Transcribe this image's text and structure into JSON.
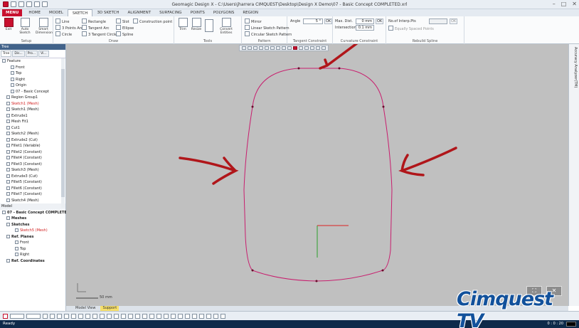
{
  "window": {
    "title": "Geomagic Design X - C:\\Users\\jharrera CIMQUEST\\Desktop\\Design X Demo\\07 - Basic Concept COMPLETED.xrl"
  },
  "menu_tabs": [
    "MENU",
    "HOME",
    "MODEL",
    "SKETCH",
    "3D SKETCH",
    "ALIGNMENT",
    "SURFACING",
    "POINTS",
    "POLYGONS",
    "REGION"
  ],
  "ribbon": {
    "setup": {
      "label": "Setup",
      "exit": "Exit",
      "auto_sketch": "Auto Sketch",
      "smart_dimension": "Smart Dimension"
    },
    "draw": {
      "label": "Draw",
      "items": [
        "Line",
        "Rectangle",
        "Slot",
        "Construction point",
        "3 Points Arc",
        "Tangent Arc",
        "Ellipse",
        "Circle",
        "3 Tangent Circle",
        "Spline"
      ]
    },
    "tools": {
      "label": "Tools",
      "items": [
        "Trim",
        "Resize",
        "Convert Entities"
      ]
    },
    "pattern": {
      "label": "Pattern",
      "items": [
        "Mirror",
        "Linear Sketch Pattern",
        "Circular Sketch Pattern"
      ]
    },
    "tangent_constraint": {
      "label": "Tangent Constraint",
      "angle_label": "Angle",
      "angle_value": "5 °",
      "ok": "OK"
    },
    "curvature_constraint": {
      "label": "Curvature Constraint",
      "max_dist_label": "Max. Dist.",
      "max_dist_value": "0 mm",
      "intersection_label": "Intersection",
      "intersection_value": "0.1 mm",
      "ok": "OK"
    },
    "rebuild_spline": {
      "label": "Rebuild Spline",
      "num_pts_label": "No.of Interp.Pts",
      "equal_spaced": "Equally Spaced Points",
      "ok": "OK"
    }
  },
  "tree_panel": {
    "title": "Tree",
    "tabs": [
      "Tree",
      "Dis...",
      "Pro...",
      "Vi..."
    ],
    "items": [
      {
        "label": "Feature",
        "indent": 0,
        "style": "normal"
      },
      {
        "label": "Front",
        "indent": 2,
        "style": "normal"
      },
      {
        "label": "Top",
        "indent": 2,
        "style": "normal"
      },
      {
        "label": "Right",
        "indent": 2,
        "style": "normal"
      },
      {
        "label": "Origin",
        "indent": 2,
        "style": "normal"
      },
      {
        "label": "07 - Basic Concept",
        "indent": 2,
        "style": "normal"
      },
      {
        "label": "Region Group1",
        "indent": 1,
        "style": "normal"
      },
      {
        "label": "Sketch1 (Mesh)",
        "indent": 1,
        "style": "red"
      },
      {
        "label": "Sketch1 (Mesh)",
        "indent": 1,
        "style": "normal"
      },
      {
        "label": "Extrude1",
        "indent": 1,
        "style": "normal"
      },
      {
        "label": "Mesh Fit1",
        "indent": 1,
        "style": "normal"
      },
      {
        "label": "Cut1",
        "indent": 1,
        "style": "normal"
      },
      {
        "label": "Sketch2 (Mesh)",
        "indent": 1,
        "style": "normal"
      },
      {
        "label": "Extrude2 (Cut)",
        "indent": 1,
        "style": "normal"
      },
      {
        "label": "Fillet1 (Variable)",
        "indent": 1,
        "style": "normal"
      },
      {
        "label": "Fillet2 (Constant)",
        "indent": 1,
        "style": "normal"
      },
      {
        "label": "Fillet4 (Constant)",
        "indent": 1,
        "style": "normal"
      },
      {
        "label": "Fillet3 (Constant)",
        "indent": 1,
        "style": "normal"
      },
      {
        "label": "Sketch3 (Mesh)",
        "indent": 1,
        "style": "normal"
      },
      {
        "label": "Extrude3 (Cut)",
        "indent": 1,
        "style": "normal"
      },
      {
        "label": "Fillet5 (Constant)",
        "indent": 1,
        "style": "normal"
      },
      {
        "label": "Fillet6 (Constant)",
        "indent": 1,
        "style": "normal"
      },
      {
        "label": "Fillet7 (Constant)",
        "indent": 1,
        "style": "normal"
      },
      {
        "label": "Sketch4 (Mesh)",
        "indent": 1,
        "style": "normal"
      }
    ],
    "model_label": "Model",
    "model_items": [
      {
        "label": "07 - Basic Concept COMPLETED",
        "indent": 0,
        "style": "bold"
      },
      {
        "label": "Meshes",
        "indent": 1,
        "style": "bold"
      },
      {
        "label": "Sketches",
        "indent": 1,
        "style": "bold"
      },
      {
        "label": "Sketch5 (Mesh)",
        "indent": 3,
        "style": "red"
      },
      {
        "label": "Ref. Planes",
        "indent": 1,
        "style": "bold"
      },
      {
        "label": "Front",
        "indent": 3,
        "style": "normal"
      },
      {
        "label": "Top",
        "indent": 3,
        "style": "normal"
      },
      {
        "label": "Right",
        "indent": 3,
        "style": "normal"
      },
      {
        "label": "Ref. Coordinates",
        "indent": 1,
        "style": "bold"
      }
    ]
  },
  "viewport": {
    "scale_label": "50 mm",
    "axis_label": "",
    "right_strip_label": "Accuracy Analyzer(TM)"
  },
  "bottom_tabs": [
    "Model View",
    "Support"
  ],
  "status": {
    "text": "Ready",
    "right": "0 : 0 : 20"
  },
  "brand": {
    "text": "Cimquest TV",
    "color": "#12519b"
  },
  "colors": {
    "sketch": "#c81e6e",
    "arrow": "#b0161a",
    "accent": "#c8102e",
    "viewport_bg": "#c0c0c0"
  }
}
